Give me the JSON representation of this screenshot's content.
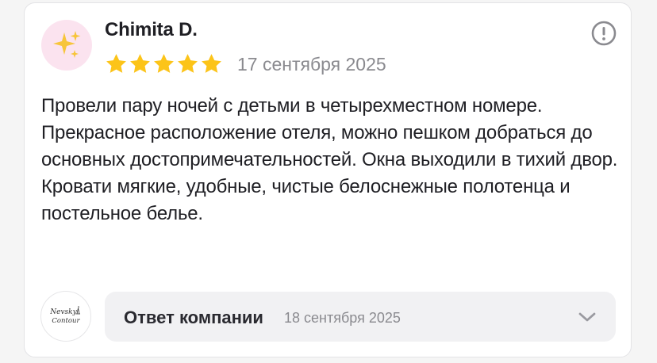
{
  "review": {
    "author": "Chimita D.",
    "rating": 5,
    "rating_max": 5,
    "date": "17 сентября 2025",
    "avatar_icon": "sparkles-icon",
    "text": "Провели пару ночей с детьми в четырехместном номере. Прекрасное расположение отеля, можно пешком добраться до основных достопримечательностей. Окна выходили в тихий двор. Кровати мягкие, удобные, чистые белоснежные полотенца и постельное белье.",
    "report_icon": "exclamation-circle-icon"
  },
  "company_reply": {
    "label": "Ответ компании",
    "date": "18 сентября 2025",
    "logo_text": "Nevsky Contour",
    "expand_icon": "chevron-down-icon"
  },
  "colors": {
    "star": "#fcc419",
    "avatar_bg": "#fbe3ef",
    "reply_bg": "#f1f1f3",
    "muted_text": "#8a8a8f"
  }
}
